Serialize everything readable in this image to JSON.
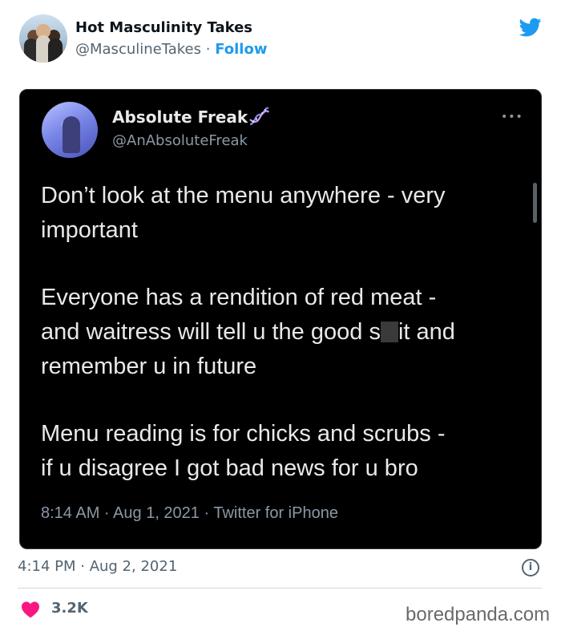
{
  "embed": {
    "account_name": "Hot Masculinity Takes",
    "handle": "@MasculineTakes",
    "separator": " · ",
    "follow_label": "Follow",
    "timestamp": "4:14 PM · Aug 2, 2021",
    "likes": "3.2K",
    "icons": {
      "brand": "twitter-bird-icon",
      "info": "info-icon",
      "like": "heart-icon"
    },
    "colors": {
      "accent": "#1d9bf0",
      "like": "#f91880",
      "muted": "#536471"
    }
  },
  "inner_tweet": {
    "name": "Absolute Freak",
    "name_icon": "dna-icon",
    "handle": "@AnAbsoluteFreak",
    "more_label": "•••",
    "paragraph_1": "Don’t look at the menu anywhere - very\nimportant",
    "paragraph_2_before": "Everyone has a rendition of red meat -\nand waitress will tell u the good s",
    "paragraph_2_after": "it and\nremember u in future",
    "paragraph_3": "Menu reading is for chicks and scrubs -\nif u disagree I got bad news for u bro",
    "meta": "8:14 AM · Aug 1, 2021 · Twitter for iPhone",
    "colors": {
      "background": "#000000",
      "text": "#e7e9ea",
      "muted": "#8b98a5"
    }
  },
  "watermark": "boredpanda.com"
}
